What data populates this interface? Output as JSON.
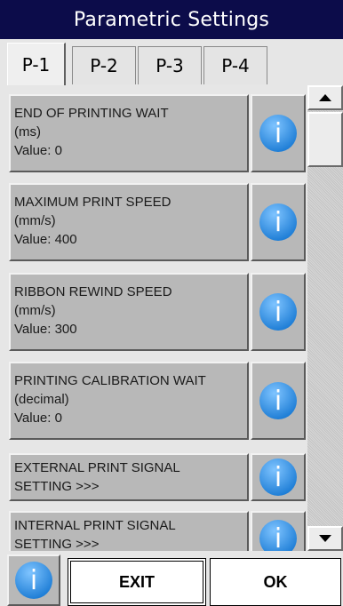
{
  "title": "Parametric Settings",
  "tabs": [
    {
      "label": "P-1",
      "active": true
    },
    {
      "label": "P-2",
      "active": false
    },
    {
      "label": "P-3",
      "active": false
    },
    {
      "label": "P-4",
      "active": false
    }
  ],
  "params": [
    {
      "name": "END OF PRINTING WAIT",
      "unit": "(ms)",
      "value": "Value: 0"
    },
    {
      "name": "MAXIMUM PRINT SPEED",
      "unit": "(mm/s)",
      "value": "Value: 400"
    },
    {
      "name": "RIBBON REWIND SPEED",
      "unit": "(mm/s)",
      "value": "Value: 300"
    },
    {
      "name": "PRINTING CALIBRATION WAIT",
      "unit": "(decimal)",
      "value": "Value: 0"
    },
    {
      "name": "EXTERNAL PRINT SIGNAL",
      "unit": "SETTING  >>>",
      "value": ""
    },
    {
      "name": "INTERNAL PRINT SIGNAL",
      "unit": "SETTING  >>>",
      "value": ""
    }
  ],
  "buttons": {
    "exit": "EXIT",
    "ok": "OK"
  },
  "info_icon_glyph": "i",
  "icons": {
    "info": "info-icon",
    "scroll_up": "arrow-up-icon",
    "scroll_down": "arrow-down-icon"
  },
  "colors": {
    "titlebar": "#0c0c4a",
    "info_blue": "#2f8fe0",
    "button_gray": "#b8b8b8"
  }
}
